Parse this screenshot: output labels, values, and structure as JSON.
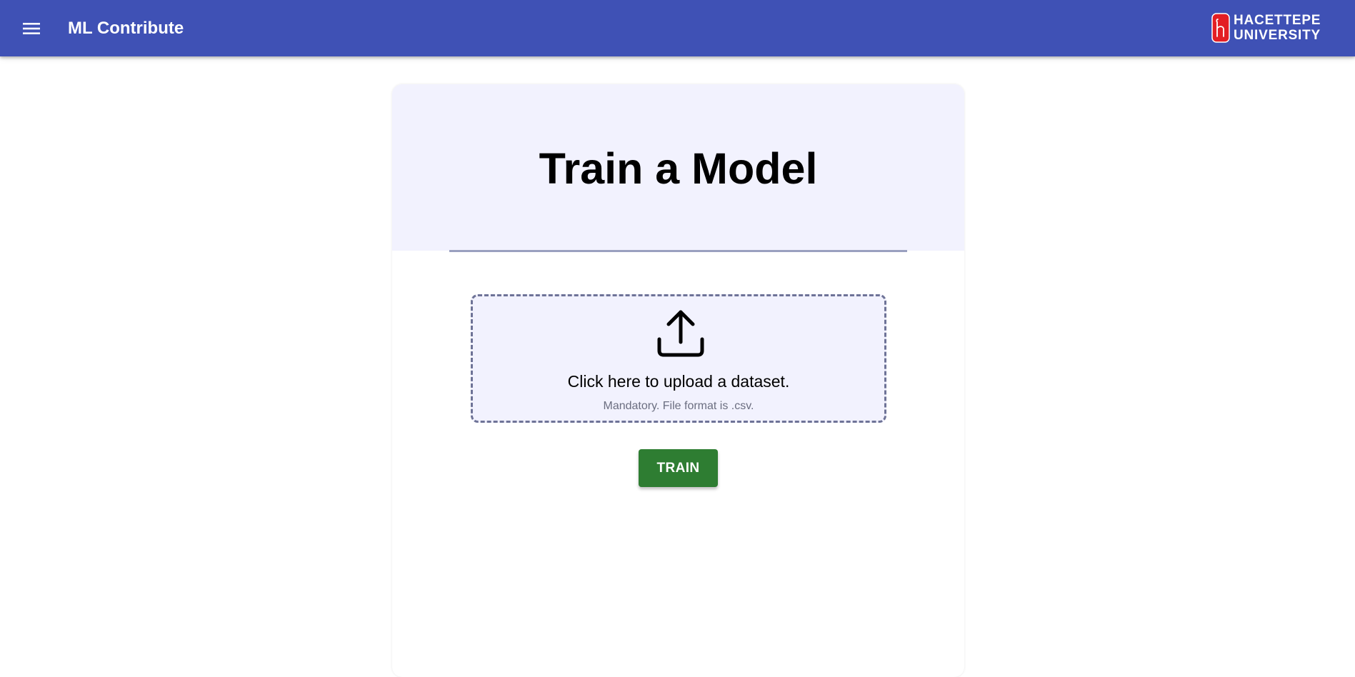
{
  "appbar": {
    "title": "ML Contribute",
    "menu_icon": "menu-icon",
    "brand": {
      "line1": "HACETTEPE",
      "line2": "UNIVERSITY",
      "logo_icon": "hacettepe-logo"
    }
  },
  "main": {
    "title": "Train a Model",
    "upload": {
      "icon": "upload-icon",
      "title": "Click here to upload a dataset.",
      "hint": "Mandatory. File format is .csv."
    },
    "train_label": "TRAIN"
  },
  "colors": {
    "appbar": "#3f51b5",
    "header_bg": "#f2f2fe",
    "train_button": "#2e7d32",
    "logo_red": "#e31e24"
  }
}
